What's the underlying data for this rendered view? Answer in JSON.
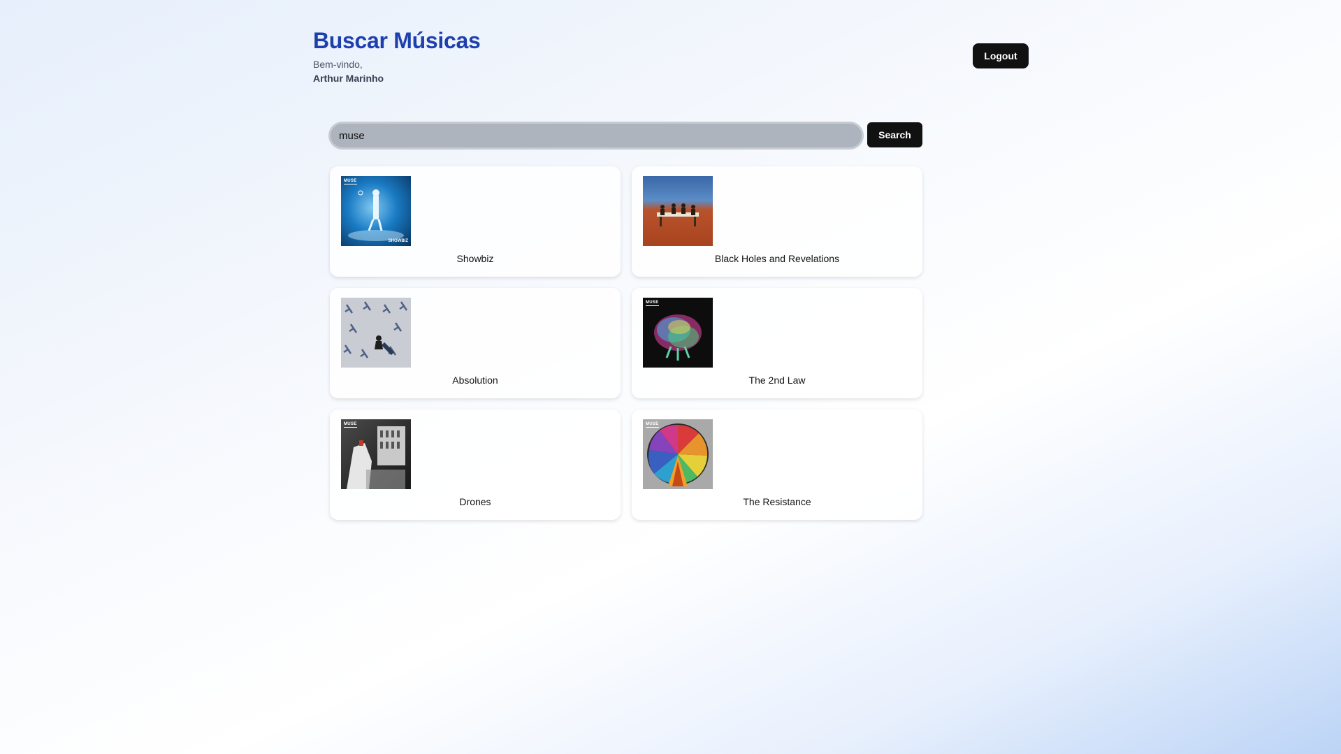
{
  "header": {
    "title": "Buscar Músicas",
    "welcome": "Bem-vindo,",
    "user_name": "Arthur Marinho",
    "logout_label": "Logout"
  },
  "search": {
    "value": "muse",
    "button_label": "Search"
  },
  "albums": [
    {
      "title": "Showbiz",
      "cover": "showbiz-cover",
      "cover_text": "SHOWBIZ",
      "logo": "MUSE"
    },
    {
      "title": "Black Holes and Revelations",
      "cover": "black-holes-cover"
    },
    {
      "title": "Absolution",
      "cover": "absolution-cover"
    },
    {
      "title": "The 2nd Law",
      "cover": "2nd-law-cover",
      "logo": "MUSE"
    },
    {
      "title": "Drones",
      "cover": "drones-cover",
      "logo": "MUSE"
    },
    {
      "title": "The Resistance",
      "cover": "resistance-cover",
      "logo": "MUSE"
    }
  ],
  "colors": {
    "title": "#1e40af",
    "button_bg": "#111111",
    "input_bg": "#adb4bd"
  }
}
